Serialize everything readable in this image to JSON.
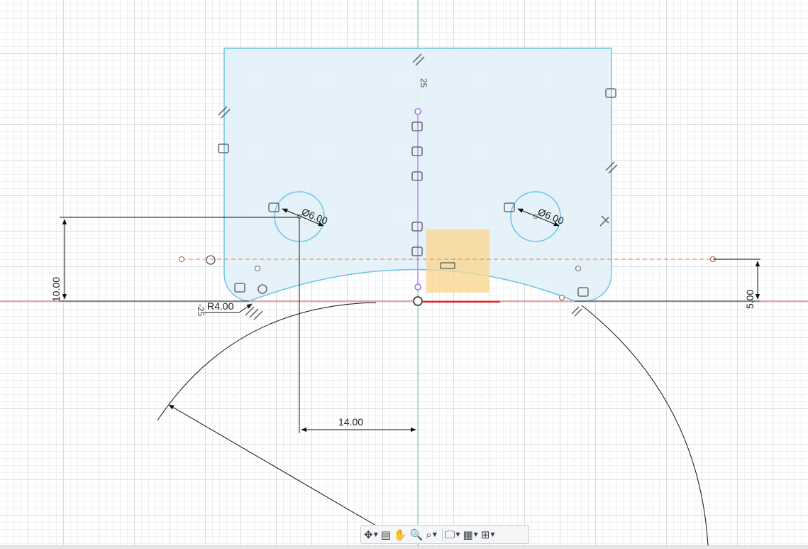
{
  "dimensions": {
    "hole_diameter_left": "Ø6.00",
    "hole_diameter_right": "Ø6.00",
    "horizontal_distance": "14.00",
    "vertical_height_left": "10.00",
    "vertical_height_right": "5.00",
    "fillet_radius": "R4.00",
    "ruler_top": "25",
    "ruler_left": "-25"
  },
  "colors": {
    "sketch_profile": "#6cc3e3",
    "profile_fill": "#e3f1fa",
    "construction_line": "#e08040",
    "center_axis": "#7cc87c",
    "x_axis": "#e84040",
    "selection": "#fbd48a",
    "vertical_constraint_line": "#b48cf0"
  },
  "toolbar": {
    "items": [
      {
        "name": "orbit",
        "icon": "orbit-icon",
        "has_dropdown": true
      },
      {
        "name": "look-at",
        "icon": "look-at-icon",
        "has_dropdown": false
      },
      {
        "name": "pan",
        "icon": "pan-hand-icon",
        "has_dropdown": false
      },
      {
        "name": "zoom",
        "icon": "zoom-icon",
        "has_dropdown": false
      },
      {
        "name": "fit",
        "icon": "zoom-fit-icon",
        "has_dropdown": true
      },
      {
        "name": "display-settings",
        "icon": "display-settings-icon",
        "has_dropdown": true
      },
      {
        "name": "grid-snaps",
        "icon": "grid-icon",
        "has_dropdown": true
      },
      {
        "name": "viewports",
        "icon": "viewports-icon",
        "has_dropdown": true
      }
    ]
  }
}
